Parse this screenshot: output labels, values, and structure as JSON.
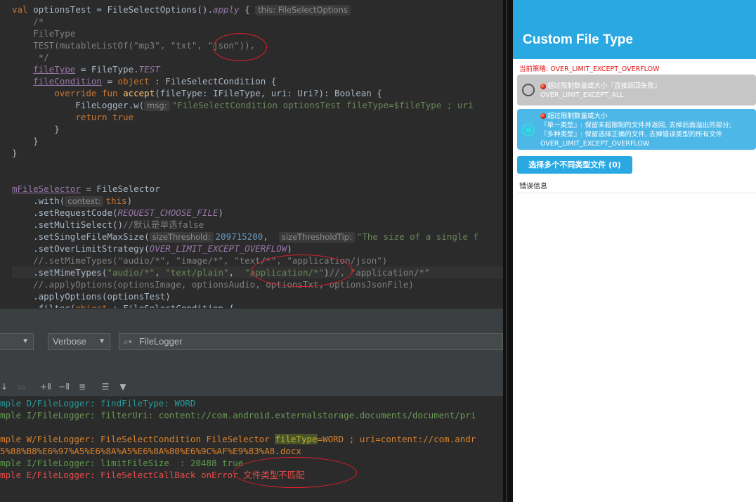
{
  "editor": {
    "lines": [
      [
        {
          "t": "val ",
          "c": "kw"
        },
        {
          "t": "optionsTest",
          "c": "plain"
        },
        {
          "t": " = FileSelectOptions().",
          "c": "plain"
        },
        {
          "t": "apply",
          "c": "ital"
        },
        {
          "t": " { ",
          "c": "plain"
        },
        {
          "t": "this: FileSelectOptions",
          "c": "hint"
        }
      ],
      [
        {
          "t": "    /*",
          "c": "com"
        }
      ],
      [
        {
          "t": "    FileType",
          "c": "com"
        }
      ],
      [
        {
          "t": "    TEST(mutableListOf(\"mp3\", \"txt\", \"json\")),",
          "c": "com"
        }
      ],
      [
        {
          "t": "     */",
          "c": "com"
        }
      ],
      [
        {
          "t": "    ",
          "c": "plain"
        },
        {
          "t": "fileType",
          "c": "prop-ul"
        },
        {
          "t": " = FileType.",
          "c": "plain"
        },
        {
          "t": "TEST",
          "c": "ital"
        }
      ],
      [
        {
          "t": "    ",
          "c": "plain"
        },
        {
          "t": "fileCondition",
          "c": "prop-ul"
        },
        {
          "t": " = ",
          "c": "plain"
        },
        {
          "t": "object",
          "c": "kw"
        },
        {
          "t": " : FileSelectCondition {",
          "c": "plain"
        }
      ],
      [
        {
          "t": "        ",
          "c": "plain"
        },
        {
          "t": "override fun ",
          "c": "kw"
        },
        {
          "t": "accept",
          "c": "fn"
        },
        {
          "t": "(fileType: IFileType, uri: Uri?): Boolean {",
          "c": "plain"
        }
      ],
      [
        {
          "t": "            FileLogger.w(",
          "c": "plain"
        },
        {
          "t": "msg:",
          "c": "hint"
        },
        {
          "t": "\"FileSelectCondition optionsTest fileType=$fileType ; uri",
          "c": "str"
        }
      ],
      [
        {
          "t": "            ",
          "c": "plain"
        },
        {
          "t": "return true",
          "c": "kw"
        }
      ],
      [
        {
          "t": "        }",
          "c": "plain"
        }
      ],
      [
        {
          "t": "    }",
          "c": "plain"
        }
      ],
      [
        {
          "t": "}",
          "c": "plain"
        }
      ],
      [
        {
          "t": "",
          "c": "plain"
        }
      ],
      [
        {
          "t": "",
          "c": "plain"
        }
      ],
      [
        {
          "t": "mFileSelector",
          "c": "prop-ul"
        },
        {
          "t": " = FileSelector",
          "c": "plain"
        }
      ],
      [
        {
          "t": "    .with(",
          "c": "plain"
        },
        {
          "t": "context:",
          "c": "hint"
        },
        {
          "t": "this",
          "c": "kw"
        },
        {
          "t": ")",
          "c": "plain"
        }
      ],
      [
        {
          "t": "    .setRequestCode(",
          "c": "plain"
        },
        {
          "t": "REQUEST_CHOOSE_FILE",
          "c": "ital"
        },
        {
          "t": ")",
          "c": "plain"
        }
      ],
      [
        {
          "t": "    .setMultiSelect()",
          "c": "plain"
        },
        {
          "t": "//默认是单选false",
          "c": "com"
        }
      ],
      [
        {
          "t": "    .setSingleFileMaxSize(",
          "c": "plain"
        },
        {
          "t": "sizeThreshold:",
          "c": "hint"
        },
        {
          "t": "209715200",
          "c": "num"
        },
        {
          "t": ",  ",
          "c": "plain"
        },
        {
          "t": "sizeThresholdTip:",
          "c": "hint"
        },
        {
          "t": "\"The size of a single f",
          "c": "str"
        }
      ],
      [
        {
          "t": "    .setOverLimitStrategy(",
          "c": "plain"
        },
        {
          "t": "OVER_LIMIT_EXCEPT_OVERFLOW",
          "c": "ital"
        },
        {
          "t": ")",
          "c": "plain"
        }
      ],
      [
        {
          "t": "    //.setMimeTypes(\"audio/*\", \"image/*\", \"text/*\", \"application/json\")",
          "c": "com"
        }
      ],
      [
        {
          "t": "    .setMimeTypes(",
          "c": "plain"
        },
        {
          "t": "\"audio/*\"",
          "c": "str"
        },
        {
          "t": ", ",
          "c": "plain"
        },
        {
          "t": "\"text/plain\"",
          "c": "str"
        },
        {
          "t": ",  ",
          "c": "plain"
        },
        {
          "t": "\"application/*\"",
          "c": "str"
        },
        {
          "t": ")",
          "c": "plain"
        },
        {
          "t": "//, \"application/*\"",
          "c": "com"
        }
      ],
      [
        {
          "t": "    //.applyOptions(optionsImage, optionsAudio, optionsTxt, optionsJsonFile)",
          "c": "com"
        }
      ],
      [
        {
          "t": "    .applyOptions(optionsTest)",
          "c": "plain"
        }
      ],
      [
        {
          "t": "    .filter(",
          "c": "plain"
        },
        {
          "t": "object",
          "c": "kw"
        },
        {
          "t": " : FileSelectCondition {",
          "c": "plain"
        }
      ]
    ]
  },
  "logcat": {
    "level": "Verbose",
    "search_value": "FileLogger",
    "lines": [
      [
        {
          "t": "mple D/FileLogger: findFileType: WORD",
          "c": "d"
        }
      ],
      [
        {
          "t": "mple I/FileLogger: filterUri: content://com.android.externalstorage.documents/document/pri",
          "c": "i"
        }
      ],
      [
        {
          "t": "",
          "c": "i"
        }
      ],
      [
        {
          "t": "mple W/FileLogger: FileSelectCondition FileSelector ",
          "c": "w"
        },
        {
          "t": "fileType",
          "c": "whl"
        },
        {
          "t": "=WORD ; uri=content://com.andr",
          "c": "w"
        }
      ],
      [
        {
          "t": "5%88%B8%E6%97%A5%E6%8A%A5%E6%8A%80%E6%9C%AF%E9%83%A8.docx",
          "c": "w"
        }
      ],
      [
        {
          "t": "mple I/FileLogger: limitFileSize  : 20488 true",
          "c": "i2"
        }
      ],
      [
        {
          "t": "mple E/FileLogger: FileSelectCallBack onError ",
          "c": "e"
        },
        {
          "t": "文件类型不匹配",
          "c": "ecn"
        }
      ]
    ]
  },
  "phone": {
    "title": "Custom File Type",
    "strategy": "当前策略: OVER_LIMIT_EXCEPT_OVERFLOW",
    "option1": {
      "line1": "超过限制数量或大小『直接返回失败』",
      "line2": "OVER_LIMIT_EXCEPT_ALL",
      "selected": false
    },
    "option2": {
      "line1": "超过限制数量或大小",
      "line2": "『单一类型』: 保留未超限制的文件并返回, 去掉后面溢出的部分;",
      "line3": "『多种类型』: 保留选择正确的文件, 去掉错误类型的所有文件",
      "line4": "OVER_LIMIT_EXCEPT_OVERFLOW",
      "selected": true
    },
    "multi_button": "选择多个不同类型文件 (0)",
    "error_label": "错误信息"
  }
}
